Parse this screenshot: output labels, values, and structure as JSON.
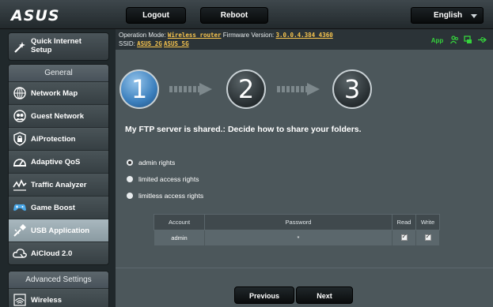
{
  "header": {
    "logo": "ASUS",
    "logout_label": "Logout",
    "reboot_label": "Reboot",
    "language": "English"
  },
  "infobar": {
    "op_mode_label": "Operation Mode:",
    "op_mode_value": "Wireless router",
    "firmware_label": "Firmware Version:",
    "firmware_value": "3.0.0.4.384_4360",
    "ssid_label": "SSID:",
    "ssid_2g": "ASUS_2G",
    "ssid_5g": "ASUS_5G",
    "app_label": "App"
  },
  "sidebar": {
    "qis_label_line1": "Quick Internet",
    "qis_label_line2": "Setup",
    "general_header": "General",
    "items": [
      {
        "label": "Network Map",
        "icon": "network-map-icon"
      },
      {
        "label": "Guest Network",
        "icon": "guest-network-icon"
      },
      {
        "label": "AiProtection",
        "icon": "lock-icon"
      },
      {
        "label": "Adaptive QoS",
        "icon": "gauge-icon"
      },
      {
        "label": "Traffic Analyzer",
        "icon": "chart-icon"
      },
      {
        "label": "Game Boost",
        "icon": "gamepad-icon"
      },
      {
        "label": "USB Application",
        "icon": "usb-icon"
      },
      {
        "label": "AiCloud 2.0",
        "icon": "cloud-icon"
      }
    ],
    "advanced_header": "Advanced Settings",
    "advanced_items": [
      {
        "label": "Wireless",
        "icon": "wifi-icon"
      }
    ]
  },
  "wizard": {
    "steps": [
      "1",
      "2",
      "3"
    ],
    "current_step": 1,
    "heading": "My FTP server is shared.: Decide how to share your folders.",
    "options": [
      "admin rights",
      "limited access rights",
      "limitless access rights"
    ],
    "selected_option": "admin rights"
  },
  "table": {
    "headers": [
      "Account",
      "Password",
      "Read",
      "Write"
    ],
    "rows": [
      {
        "account": "admin",
        "password": "*",
        "read": true,
        "write": true
      }
    ]
  },
  "buttons": {
    "previous": "Previous",
    "next": "Next"
  },
  "colors": {
    "accent_blue": "#3b7fbd",
    "value_yellow": "#f7c44e",
    "status_green": "#35d33c"
  }
}
